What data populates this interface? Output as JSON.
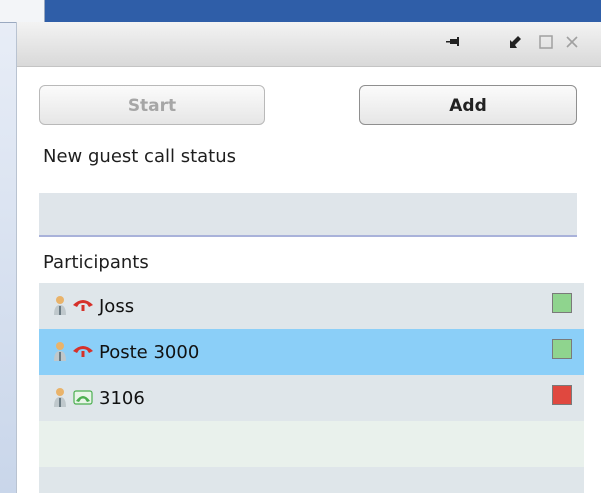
{
  "window": {
    "title_icons": [
      "pin-icon",
      "restore-down-icon",
      "maximize-icon",
      "close-icon"
    ]
  },
  "actions": {
    "start_label": "Start",
    "add_label": "Add"
  },
  "guest_call": {
    "heading": "New guest call status",
    "value": ""
  },
  "participants": {
    "heading": "Participants",
    "rows": [
      {
        "name": "Joss",
        "phone_icon": "hangup-icon",
        "status_color": "#8fd48e",
        "selected": false
      },
      {
        "name": "Poste 3000",
        "phone_icon": "hangup-icon",
        "status_color": "#8fd48e",
        "selected": true
      },
      {
        "name": "3106",
        "phone_icon": "active-call-icon",
        "status_color": "#e0483f",
        "selected": false
      }
    ]
  },
  "colors": {
    "selection": "#8bcff8",
    "status_green": "#8fd48e",
    "status_red": "#e0483f",
    "hangup_red": "#d6312a",
    "call_green": "#4caf50"
  }
}
